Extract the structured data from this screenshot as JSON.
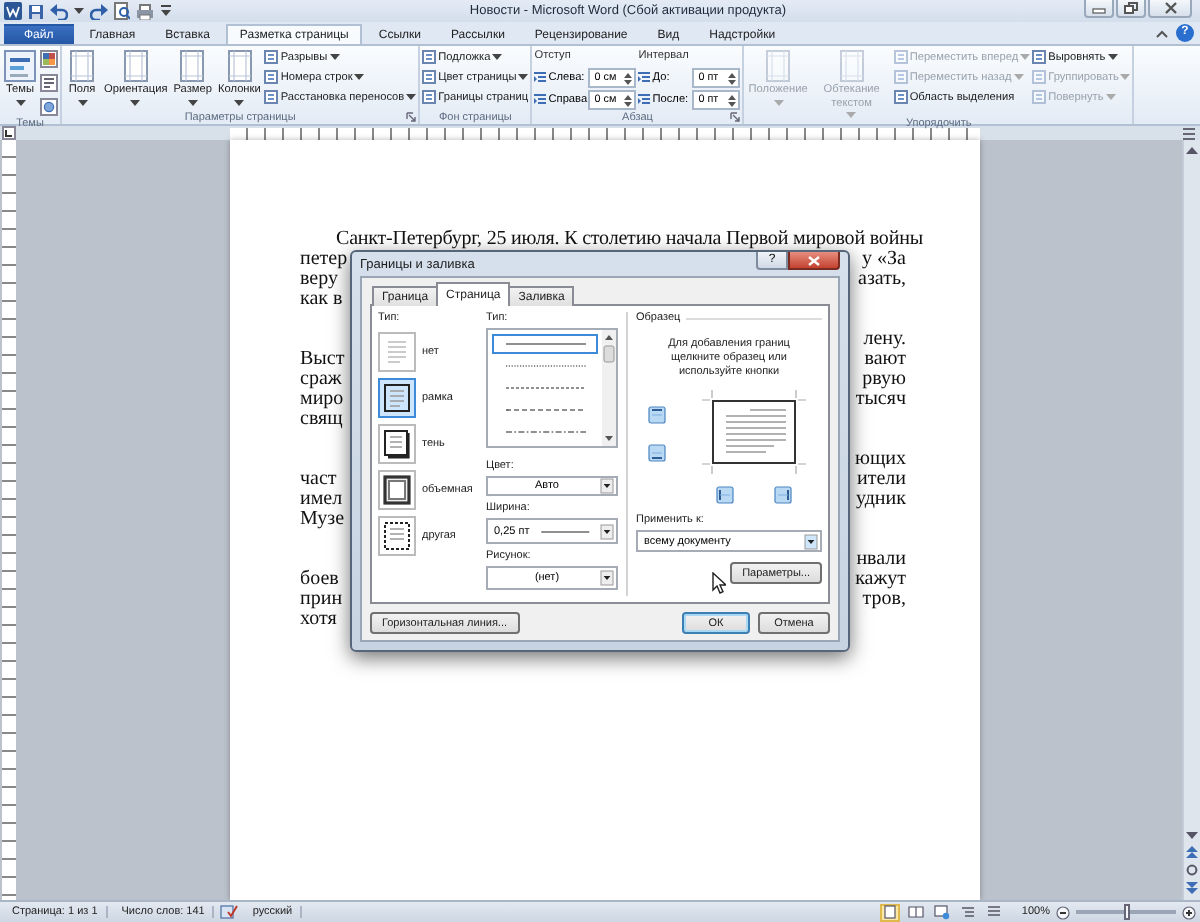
{
  "window": {
    "title": "Новости - Microsoft Word (Сбой активации продукта)"
  },
  "tabs": [
    {
      "label": "Файл",
      "kind": "file",
      "selected": false
    },
    {
      "label": "Главная",
      "kind": "tab",
      "selected": false
    },
    {
      "label": "Вставка",
      "kind": "tab",
      "selected": false
    },
    {
      "label": "Разметка страницы",
      "kind": "tab",
      "selected": true
    },
    {
      "label": "Ссылки",
      "kind": "tab",
      "selected": false
    },
    {
      "label": "Рассылки",
      "kind": "tab",
      "selected": false
    },
    {
      "label": "Рецензирование",
      "kind": "tab",
      "selected": false
    },
    {
      "label": "Вид",
      "kind": "tab",
      "selected": false
    },
    {
      "label": "Надстройки",
      "kind": "tab",
      "selected": false
    }
  ],
  "help_button": "?",
  "ribbon": {
    "groups": [
      {
        "title": "Темы",
        "launcher": false,
        "columns": [
          [
            {
              "kind": "large",
              "label": "Темы",
              "dropdown": true,
              "disabled": false
            }
          ],
          [
            {
              "kind": "icon_button"
            },
            {
              "kind": "icon_button"
            },
            {
              "kind": "icon_button"
            }
          ]
        ]
      },
      {
        "title": "Параметры страницы",
        "launcher": true,
        "columns": [
          [
            {
              "kind": "large",
              "label": "Поля",
              "dropdown": true,
              "disabled": false
            }
          ],
          [
            {
              "kind": "large",
              "label": "Ориентация",
              "dropdown": true,
              "disabled": false
            }
          ],
          [
            {
              "kind": "large",
              "label": "Размер",
              "dropdown": true,
              "disabled": false
            }
          ],
          [
            {
              "kind": "large",
              "label": "Колонки",
              "dropdown": true,
              "disabled": false
            }
          ],
          [
            {
              "kind": "small",
              "label": "Разрывы",
              "dropdown": true,
              "disabled": false
            },
            {
              "kind": "small",
              "label": "Номера строк",
              "dropdown": true,
              "disabled": false
            },
            {
              "kind": "small",
              "label": "Расстановка переносов",
              "dropdown": true,
              "disabled": false
            }
          ]
        ]
      },
      {
        "title": "Фон страницы",
        "launcher": false,
        "columns": [
          [
            {
              "kind": "small",
              "label": "Подложка",
              "dropdown": true,
              "disabled": false
            },
            {
              "kind": "small",
              "label": "Цвет страницы",
              "dropdown": true,
              "disabled": false
            },
            {
              "kind": "small",
              "label": "Границы страниц",
              "dropdown": false,
              "disabled": false
            }
          ]
        ]
      },
      {
        "title": "Абзац",
        "launcher": true,
        "columns": [
          [
            {
              "kind": "heading",
              "label": "Отступ"
            },
            {
              "kind": "spin",
              "label": "Слева:",
              "value": "0 см"
            },
            {
              "kind": "spin",
              "label": "Справа:",
              "value": "0 см"
            }
          ],
          [
            {
              "kind": "heading",
              "label": "Интервал"
            },
            {
              "kind": "spin",
              "label": "До:",
              "value": "0 пт"
            },
            {
              "kind": "spin",
              "label": "После:",
              "value": "0 пт"
            }
          ]
        ]
      },
      {
        "title": "Упорядочить",
        "launcher": false,
        "columns": [
          [
            {
              "kind": "large",
              "label": "Положение",
              "dropdown": true,
              "disabled": true
            }
          ],
          [
            {
              "kind": "large",
              "label": "Обтекание текстом",
              "dropdown": true,
              "disabled": true
            }
          ],
          [
            {
              "kind": "small",
              "label": "Переместить вперед",
              "dropdown": true,
              "disabled": true
            },
            {
              "kind": "small",
              "label": "Переместить назад",
              "dropdown": true,
              "disabled": true
            },
            {
              "kind": "small",
              "label": "Область выделения",
              "dropdown": false,
              "disabled": false
            }
          ],
          [
            {
              "kind": "small",
              "label": "Выровнять",
              "dropdown": true,
              "disabled": false
            },
            {
              "kind": "small",
              "label": "Группировать",
              "dropdown": true,
              "disabled": true
            },
            {
              "kind": "small",
              "label": "Повернуть",
              "dropdown": true,
              "disabled": true
            }
          ]
        ]
      }
    ]
  },
  "document": {
    "paragraphs": [
      {
        "lines": [
          {
            "text": "Санкт-Петербург, 25 июля. К столетию начала Первой мировой войны"
          },
          {
            "left": "петер",
            "right": "у «За"
          },
          {
            "left": "веру",
            "right": "азать,"
          },
          {
            "left": "как в"
          }
        ]
      },
      {
        "lines": [
          {
            "right": "лену."
          },
          {
            "left": "Выст",
            "right": "вают"
          },
          {
            "left": "сраж",
            "right": "рвую"
          },
          {
            "left": "миро",
            "right": "тысяч"
          },
          {
            "left": "свящ"
          }
        ]
      },
      {
        "lines": [
          {
            "right": "ющих"
          },
          {
            "left": "част",
            "right": "ители"
          },
          {
            "left": "имел",
            "right": "удник"
          },
          {
            "left": "Музе"
          }
        ]
      },
      {
        "lines": [
          {
            "right": "нвали"
          },
          {
            "left": "боев",
            "right": "кажут"
          },
          {
            "left": "прин",
            "right": "тров,"
          },
          {
            "left": "хотя"
          }
        ]
      }
    ]
  },
  "dialog": {
    "title": "Границы и заливка",
    "help": "?",
    "tabs": [
      {
        "label": "Граница",
        "selected": false
      },
      {
        "label": "Страница",
        "selected": true
      },
      {
        "label": "Заливка",
        "selected": false
      }
    ],
    "setting": {
      "label": "Тип:",
      "options": [
        {
          "label": "нет",
          "kind": "none",
          "selected": false
        },
        {
          "label": "рамка",
          "kind": "box",
          "selected": true
        },
        {
          "label": "тень",
          "kind": "shadow",
          "selected": false
        },
        {
          "label": "объемная",
          "kind": "raised",
          "selected": false
        },
        {
          "label": "другая",
          "kind": "custom",
          "selected": false
        }
      ]
    },
    "style": {
      "label": "Тип:",
      "options": [
        {
          "kind": "solid",
          "selected": true
        },
        {
          "kind": "dotted",
          "selected": false
        },
        {
          "kind": "fine_dashed",
          "selected": false
        },
        {
          "kind": "dashed",
          "selected": false
        },
        {
          "kind": "dash_dot",
          "selected": false
        }
      ]
    },
    "color": {
      "label": "Цвет:",
      "value": "Авто"
    },
    "width": {
      "label": "Ширина:",
      "value": "0,25 пт"
    },
    "art": {
      "label": "Рисунок:",
      "value": "(нет)"
    },
    "preview": {
      "label": "Образец",
      "hint": "Для добавления границ щелкните образец или используйте кнопки"
    },
    "apply_to": {
      "label": "Применить к:",
      "value": "всему документу"
    },
    "options_button": "Параметры...",
    "footer_buttons": [
      {
        "label": "Горизонтальная линия...",
        "kind": "left",
        "default": false
      },
      {
        "label": "ОК",
        "kind": "right",
        "default": true
      },
      {
        "label": "Отмена",
        "kind": "right",
        "default": false
      }
    ]
  },
  "status_bar": {
    "page": "Страница: 1 из 1",
    "words": "Число слов: 141",
    "language": "русский",
    "views": [
      {
        "kind": "print_layout",
        "selected": true
      },
      {
        "kind": "reading",
        "selected": false
      },
      {
        "kind": "web",
        "selected": false
      },
      {
        "kind": "outline",
        "selected": false
      },
      {
        "kind": "draft",
        "selected": false
      }
    ],
    "zoom": {
      "label": "100%",
      "level": 0.5
    }
  }
}
